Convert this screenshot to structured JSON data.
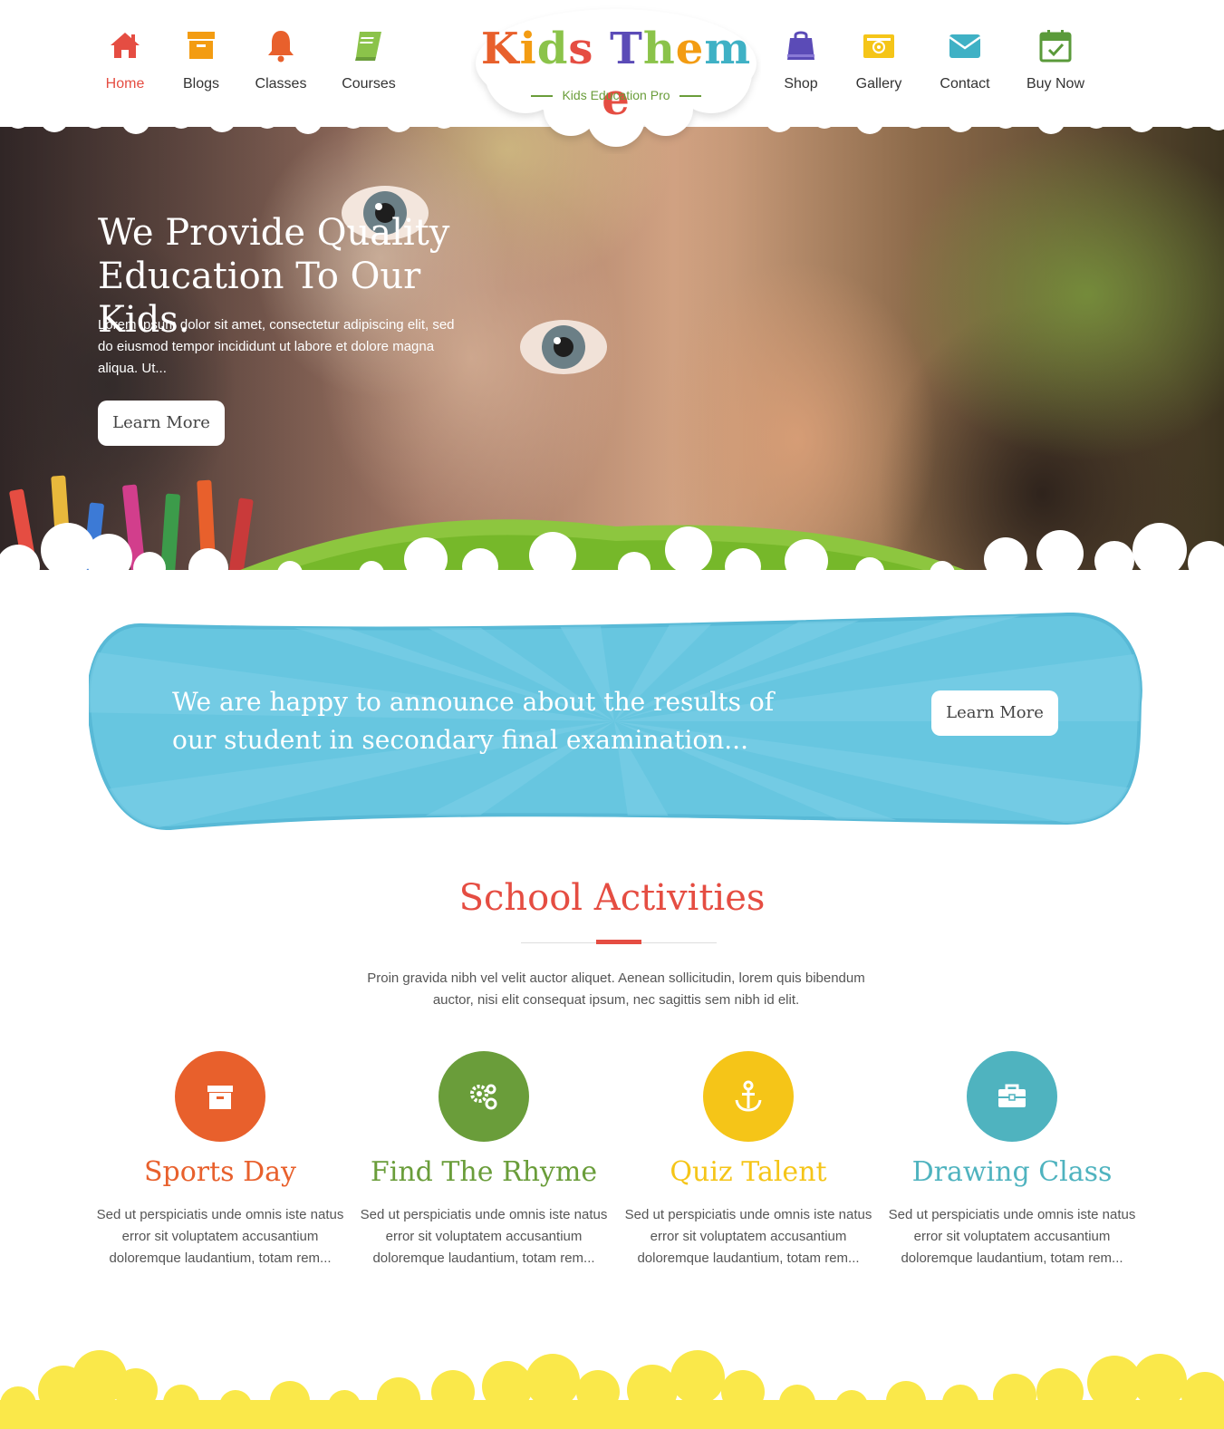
{
  "nav": {
    "left": [
      {
        "label": "Home",
        "icon": "home-icon",
        "color": "#e54d42"
      },
      {
        "label": "Blogs",
        "icon": "archive-icon",
        "color": "#f39c12"
      },
      {
        "label": "Classes",
        "icon": "bell-icon",
        "color": "#e8602c"
      },
      {
        "label": "Courses",
        "icon": "book-icon",
        "color": "#8bc34a"
      }
    ],
    "right": [
      {
        "label": "Shop",
        "icon": "shopping-bag-icon",
        "color": "#5b4bb7"
      },
      {
        "label": "Gallery",
        "icon": "camera-icon",
        "color": "#f5c518"
      },
      {
        "label": "Contact",
        "icon": "envelope-icon",
        "color": "#3fb1c5"
      },
      {
        "label": "Buy Now",
        "icon": "calendar-check-icon",
        "color": "#5a9a3a"
      }
    ]
  },
  "logo": {
    "title_letters": [
      "K",
      "i",
      "d",
      "s",
      " ",
      "T",
      "h",
      "e",
      "m",
      "e"
    ],
    "title_colors": [
      "#e8602c",
      "#f39c12",
      "#8bc34a",
      "#e54d42",
      "#ffffff",
      "#5b4bb7",
      "#8bc34a",
      "#f39c12",
      "#3fb1c5",
      "#e54d42"
    ],
    "subtitle": "Kids Education Pro"
  },
  "hero": {
    "title": "We Provide Quality Education To Our Kids.",
    "text": "Lorem ipsum dolor sit amet, consectetur adipiscing elit, sed do eiusmod tempor incididunt ut labore et dolore magna aliqua. Ut...",
    "button": "Learn More"
  },
  "banner": {
    "text": "We are happy to announce about the results of our student in secondary final examination...",
    "button": "Learn More",
    "color": "#67c6e0"
  },
  "activities": {
    "title": "School Activities",
    "description": "Proin gravida nibh vel velit auctor aliquet. Aenean sollicitudin, lorem quis bibendum auctor, nisi elit consequat ipsum, nec sagittis sem nibh id elit.",
    "items": [
      {
        "title": "Sports Day",
        "color": "#e8602c",
        "icon": "archive-icon",
        "text": "Sed ut perspiciatis unde omnis iste natus error sit voluptatem accusantium doloremque laudantium, totam rem..."
      },
      {
        "title": "Find The Rhyme",
        "color": "#6a9d3a",
        "icon": "gears-icon",
        "text": "Sed ut perspiciatis unde omnis iste natus error sit voluptatem accusantium doloremque laudantium, totam rem..."
      },
      {
        "title": "Quiz Talent",
        "color": "#f5c518",
        "icon": "anchor-icon",
        "text": "Sed ut perspiciatis unde omnis iste natus error sit voluptatem accusantium doloremque laudantium, totam rem..."
      },
      {
        "title": "Drawing Class",
        "color": "#4fb3bf",
        "icon": "briefcase-icon",
        "text": "Sed ut perspiciatis unde omnis iste natus error sit voluptatem accusantium doloremque laudantium, totam rem..."
      }
    ]
  }
}
